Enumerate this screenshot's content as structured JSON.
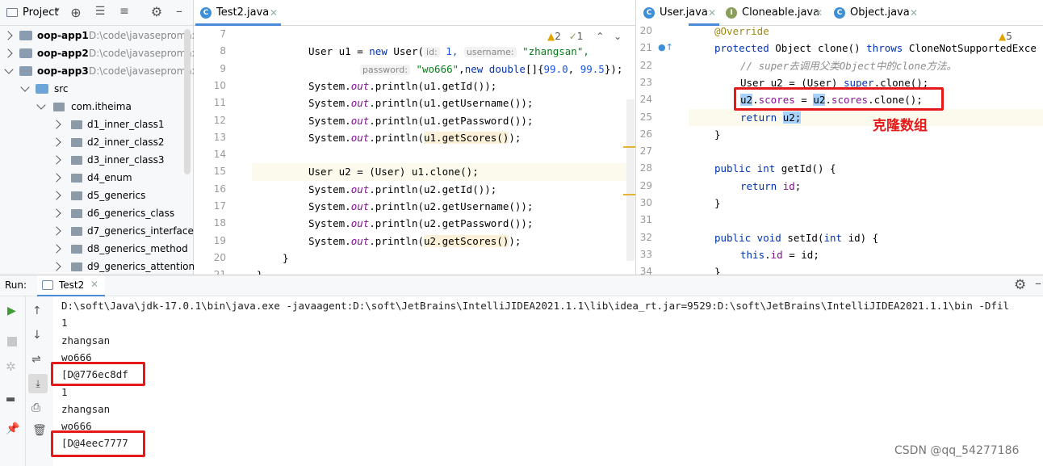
{
  "project_panel": {
    "title": "Project",
    "tree": [
      {
        "label": "oop-app1",
        "path": "D:\\code\\javasepromax",
        "expanded": false,
        "bold": true
      },
      {
        "label": "oop-app2",
        "path": "D:\\code\\javasepromax",
        "expanded": false,
        "bold": true
      },
      {
        "label": "oop-app3",
        "path": "D:\\code\\javasepromax",
        "expanded": true,
        "bold": true
      },
      {
        "label": "src",
        "path": "",
        "expanded": true,
        "bold": false
      },
      {
        "label": "com.itheima",
        "path": "",
        "expanded": true,
        "bold": false
      },
      {
        "label": "d1_inner_class1"
      },
      {
        "label": "d2_inner_class2"
      },
      {
        "label": "d3_inner_class3"
      },
      {
        "label": "d4_enum"
      },
      {
        "label": "d5_generics"
      },
      {
        "label": "d6_generics_class"
      },
      {
        "label": "d7_generics_interface"
      },
      {
        "label": "d8_generics_method"
      },
      {
        "label": "d9_generics_attention"
      }
    ]
  },
  "left_editor": {
    "tab": "Test2.java",
    "inspections": {
      "warnings": "2",
      "weak": "1"
    },
    "lines": [
      "7",
      "8",
      "9",
      "10",
      "11",
      "12",
      "13",
      "14",
      "15",
      "16",
      "17",
      "18",
      "19",
      "20",
      "21"
    ],
    "code": {
      "l8a": "User u1 = ",
      "l8b": "new ",
      "l8c": "User(",
      "l8_hint1": "id:",
      "l8d": " 1, ",
      "l8_hint2": "username:",
      "l8e": " \"zhangsan\",",
      "l9_hint": "password:",
      "l9a": " \"wo666\"",
      "l9b": ",",
      "l9c": "new ",
      "l9d": "double",
      "l9e": "[]{",
      "l9f": "99.0",
      "l9g": ", ",
      "l9h": "99.5",
      "l9i": "});",
      "sys": "System.",
      "out": "out",
      "l10": ".println(u1.getId());",
      "l11": ".println(u1.getUsername());",
      "l12": ".println(u1.getPassword());",
      "l13a": ".println(",
      "l13b": "u1.getScores()",
      "l13c": ");",
      "l15": "User u2 = (User) u1.clone();",
      "l16": ".println(u2.getId());",
      "l17": ".println(u2.getUsername());",
      "l18": ".println(u2.getPassword());",
      "l19a": ".println(",
      "l19b": "u2.getScores()",
      "l19c": ");",
      "l20": "}",
      "l21": "}"
    }
  },
  "right_editor": {
    "tabs": [
      "User.java",
      "Cloneable.java",
      "Object.java"
    ],
    "inspections": {
      "warnings": "5"
    },
    "lines": [
      "20",
      "21",
      "22",
      "23",
      "24",
      "25",
      "26",
      "27",
      "28",
      "29",
      "30",
      "31",
      "32",
      "33",
      "34"
    ],
    "code": {
      "l20": "@Override",
      "l21a": "protected ",
      "l21b": "Object clone() ",
      "l21c": "throws ",
      "l21d": "CloneNotSupportedExce",
      "l22": "// super去调用父类Object中的clone方法。",
      "l23a": "User u2 = (User) ",
      "l23b": "super",
      "l23c": ".clone();",
      "l24a": "u2",
      "l24b": ".",
      "l24c": "scores",
      "l24d": " = ",
      "l24e": "u2",
      "l24f": ".",
      "l24g": "scores",
      "l24h": ".clone();",
      "l25a": "return ",
      "l25b": "u2;",
      "l26": "}",
      "l28a": "public int ",
      "l28b": "getId() {",
      "l29a": "return ",
      "l29b": "id",
      "l29c": ";",
      "l30": "}",
      "l32a": "public void ",
      "l32b": "setId(",
      "l32c": "int ",
      "l32d": "id) {",
      "l33a": "this",
      "l33b": ".",
      "l33c": "id",
      "l33d": " = id;",
      "l34": "}"
    },
    "annotation": "克隆数组"
  },
  "run_panel": {
    "label": "Run:",
    "tab": "Test2",
    "output": [
      "D:\\soft\\Java\\jdk-17.0.1\\bin\\java.exe -javaagent:D:\\soft\\JetBrains\\IntelliJIDEA2021.1.1\\lib\\idea_rt.jar=9529:D:\\soft\\JetBrains\\IntelliJIDEA2021.1.1\\bin -Dfil",
      "1",
      "zhangsan",
      "wo666",
      "[D@776ec8df",
      "1",
      "zhangsan",
      "wo666",
      "[D@4eec7777"
    ]
  },
  "watermark": "CSDN @qq_54277186",
  "colors": {
    "highlight_box": "#e41a1a",
    "annotation": "#e41a1a",
    "accent": "#4a88d8"
  }
}
